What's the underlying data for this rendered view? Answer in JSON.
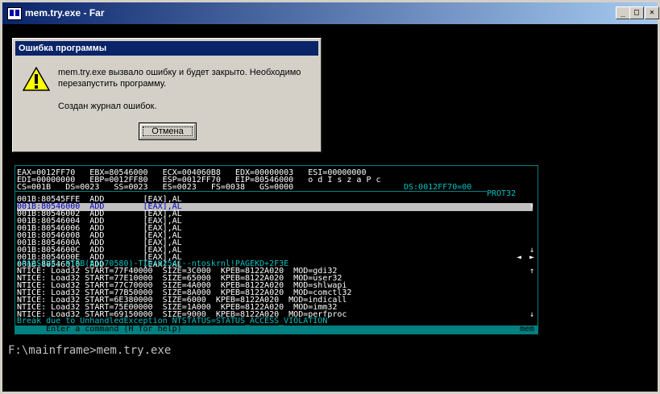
{
  "window": {
    "title": "mem.try.exe - Far",
    "min_label": "_",
    "max_label": "□",
    "close_label": "✕"
  },
  "dialog": {
    "title": "Ошибка программы",
    "message": "mem.try.exe вызвало ошибку и будет закрыто.  Необходимо\nперезапустить программу.",
    "log_text": "Создан журнал ошибок.",
    "cancel_label": "Отмена",
    "icon": "warning-icon"
  },
  "softice": {
    "reg1": "EAX=0012FF70   EBX=80546000   ECX=004060B8   EDX=00000003   ESI=00000000",
    "reg2": "EDI=00000000   EBP=0012FF80   ESP=0012FF70   EIP=80546000   o d I s z a P c",
    "reg3": "CS=001B   DS=0023   SS=0023   ES=0023   FS=0038   GS=0000",
    "reg3b": "DS:0012FF70=00",
    "prot_label": "PROT32",
    "code": [
      "001B:80545FFE  ADD        [EAX],AL",
      "001B:80546000  ADD        [EAX],AL",
      "001B:80546002  ADD        [EAX],AL",
      "001B:80546004  ADD        [EAX],AL",
      "001B:80546006  ADD        [EAX],AL",
      "001B:80546008  ADD        [EAX],AL",
      "001B:8054600A  ADD        [EAX],AL",
      "001B:8054600C  ADD        [EAX],AL",
      "001B:8054600E  ADD        [EAX],AL",
      "001B:80546010  ADD        [EAX],AL"
    ],
    "status": "(PASSIVE)-KTEB(81170580)-TID(0254)--ntoskrnl!PAGEKD+2F3E",
    "log": [
      "NTICE: Load32 START=77F40000  SIZE=3C000  KPEB=8122A020  MOD=gdi32",
      "NTICE: Load32 START=77E10000  SIZE=65000  KPEB=8122A020  MOD=user32",
      "NTICE: Load32 START=77C70000  SIZE=4A000  KPEB=8122A020  MOD=shlwapi",
      "NTICE: Load32 START=77B50000  SIZE=8A000  KPEB=8122A020  MOD=comctl32",
      "NTICE: Load32 START=6E380000  SIZE=6000  KPEB=8122A020  MOD=indicall",
      "NTICE: Load32 START=75E00000  SIZE=1A000  KPEB=8122A020  MOD=imm32",
      "NTICE: Load32 START=69150000  SIZE=9000  KPEB=8122A020  MOD=perfproc"
    ],
    "break": "Break due to UnhandledException NTSTATUS=STATUS_ACCESS_VIOLATION",
    "input": ":",
    "cmd_hint": "     Enter a command (H for help)",
    "mem_label": "mem"
  },
  "console": {
    "prompt": "F:\\mainframe>mem.try.exe"
  }
}
